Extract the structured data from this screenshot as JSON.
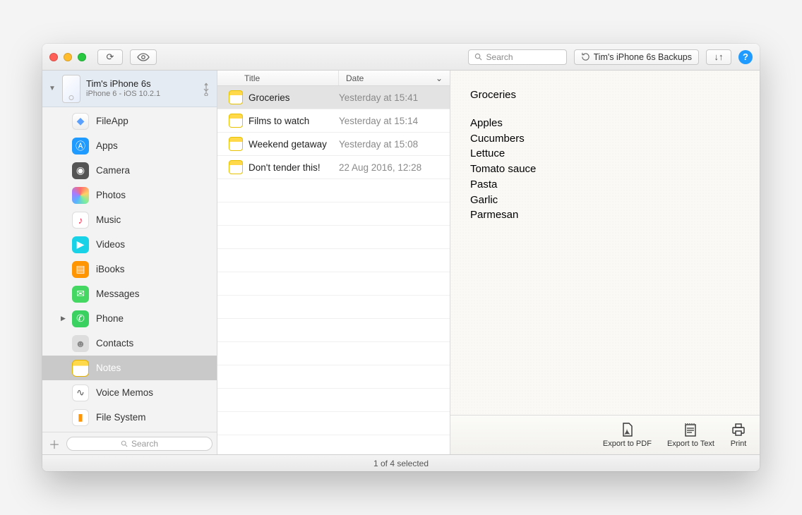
{
  "toolbar": {
    "search_placeholder": "Search",
    "backups_label": "Tim's iPhone 6s Backups"
  },
  "device": {
    "name": "Tim's iPhone 6s",
    "sub": "iPhone 6 - iOS 10.2.1"
  },
  "sidebar": {
    "items": [
      {
        "label": "FileApp",
        "icon": "fileapp",
        "selected": false,
        "expand": ""
      },
      {
        "label": "Apps",
        "icon": "apps",
        "selected": false,
        "expand": ""
      },
      {
        "label": "Camera",
        "icon": "camera",
        "selected": false,
        "expand": ""
      },
      {
        "label": "Photos",
        "icon": "photos",
        "selected": false,
        "expand": ""
      },
      {
        "label": "Music",
        "icon": "music",
        "selected": false,
        "expand": ""
      },
      {
        "label": "Videos",
        "icon": "videos",
        "selected": false,
        "expand": ""
      },
      {
        "label": "iBooks",
        "icon": "ibooks",
        "selected": false,
        "expand": ""
      },
      {
        "label": "Messages",
        "icon": "messages",
        "selected": false,
        "expand": ""
      },
      {
        "label": "Phone",
        "icon": "phone",
        "selected": false,
        "expand": "▶"
      },
      {
        "label": "Contacts",
        "icon": "contacts",
        "selected": false,
        "expand": ""
      },
      {
        "label": "Notes",
        "icon": "notes",
        "selected": true,
        "expand": ""
      },
      {
        "label": "Voice Memos",
        "icon": "voice",
        "selected": false,
        "expand": ""
      },
      {
        "label": "File System",
        "icon": "fs",
        "selected": false,
        "expand": ""
      }
    ],
    "search_placeholder": "Search"
  },
  "list": {
    "header_title": "Title",
    "header_date": "Date",
    "rows": [
      {
        "title": "Groceries",
        "date": "Yesterday at 15:41",
        "selected": true
      },
      {
        "title": "Films to watch",
        "date": "Yesterday at 15:14",
        "selected": false
      },
      {
        "title": "Weekend getaway",
        "date": "Yesterday at 15:08",
        "selected": false
      },
      {
        "title": "Don't tender this!",
        "date": "22 Aug 2016, 12:28",
        "selected": false
      }
    ]
  },
  "preview": {
    "title": "Groceries",
    "lines": [
      "Apples",
      "Cucumbers",
      "Lettuce",
      "Tomato sauce",
      "Pasta",
      "Garlic",
      "Parmesan"
    ],
    "actions": {
      "export_pdf": "Export to PDF",
      "export_text": "Export to Text",
      "print": "Print"
    }
  },
  "status": "1 of 4 selected"
}
